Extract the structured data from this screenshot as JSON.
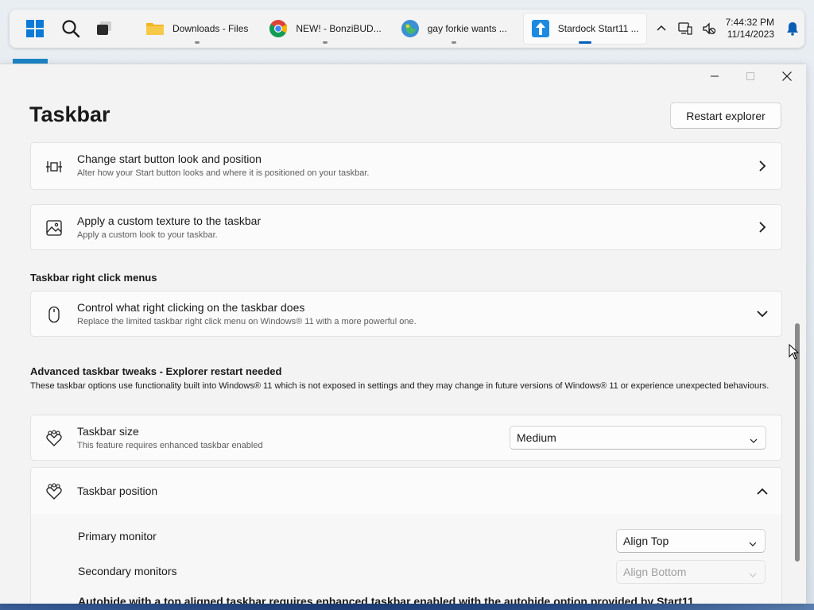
{
  "taskbar": {
    "apps": [
      {
        "label": "Downloads - Files",
        "icon": "folder-icon"
      },
      {
        "label": "NEW! - BonziBUD...",
        "icon": "chrome-icon"
      },
      {
        "label": "gay forkie wants ...",
        "icon": "app-icon"
      },
      {
        "label": "Stardock Start11 ...",
        "icon": "start11-icon",
        "active": true
      }
    ],
    "clock": {
      "time": "7:44:32 PM",
      "date": "11/14/2023"
    }
  },
  "window": {
    "title": "Taskbar",
    "restart_button": "Restart explorer",
    "cards": {
      "start_button": {
        "title": "Change start button look and position",
        "desc": "Alter how your Start button looks and where it is positioned on your taskbar."
      },
      "texture": {
        "title": "Apply a custom texture to the taskbar",
        "desc": "Apply a custom look to your taskbar."
      },
      "right_click": {
        "title": "Control what right clicking on the taskbar does",
        "desc": "Replace the limited taskbar right click menu on Windows® 11 with a more powerful one."
      },
      "size": {
        "title": "Taskbar size",
        "desc": "This feature requires enhanced taskbar enabled",
        "value": "Medium"
      },
      "position": {
        "title": "Taskbar position"
      }
    },
    "sections": {
      "right_click_menus": "Taskbar right click menus",
      "advanced": "Advanced taskbar tweaks - Explorer restart needed",
      "advanced_desc": "These taskbar options use functionality built into Windows® 11 which is not exposed in settings and they may change in future versions of Windows® 11 or experience unexpected behaviours."
    },
    "position_options": {
      "primary_label": "Primary monitor",
      "primary_value": "Align Top",
      "secondary_label": "Secondary monitors",
      "secondary_value": "Align Bottom"
    },
    "note": "Autohide with a top aligned taskbar requires enhanced taskbar enabled with the autohide option provided by Start11"
  },
  "colors": {
    "accent": "#005fb8",
    "background": "#f3f3f3",
    "card": "#fbfbfb"
  }
}
